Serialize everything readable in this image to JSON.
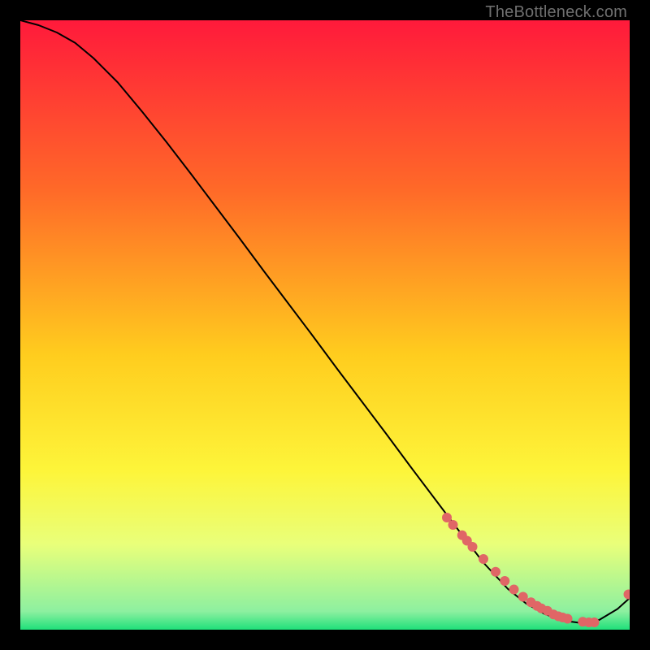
{
  "watermark": "TheBottleneck.com",
  "colors": {
    "background": "#000000",
    "gradient_top": "#ff1a3b",
    "gradient_mid1": "#ff6a28",
    "gradient_mid2": "#ffcd1e",
    "gradient_mid3": "#fdf53a",
    "gradient_bottom_top": "#e9ff7a",
    "gradient_green": "#1fe07a",
    "curve": "#000000",
    "marker": "#e06666"
  },
  "chart_data": {
    "type": "line",
    "title": "",
    "xlabel": "",
    "ylabel": "",
    "xlim": [
      0,
      100
    ],
    "ylim": [
      0,
      100
    ],
    "series": [
      {
        "name": "curve",
        "x": [
          0,
          3,
          6,
          9,
          12,
          16,
          20,
          24,
          28,
          32,
          36,
          40,
          44,
          48,
          52,
          56,
          60,
          64,
          68,
          72,
          76,
          80,
          83,
          86,
          89,
          92,
          95,
          98,
          100
        ],
        "y": [
          100,
          99.2,
          98.0,
          96.3,
          93.8,
          89.8,
          85.0,
          80.0,
          74.8,
          69.5,
          64.2,
          58.8,
          53.5,
          48.2,
          42.8,
          37.5,
          32.2,
          26.8,
          21.5,
          16.2,
          11.0,
          6.7,
          4.3,
          2.6,
          1.5,
          1.1,
          1.6,
          3.4,
          5.2
        ]
      },
      {
        "name": "markers",
        "x": [
          70.0,
          71.0,
          72.5,
          73.3,
          74.2,
          76.0,
          78.0,
          79.5,
          81.0,
          82.5,
          83.8,
          84.8,
          85.5,
          86.5,
          87.5,
          88.3,
          89.0,
          89.8,
          92.3,
          93.3,
          94.2,
          99.8
        ],
        "y": [
          18.4,
          17.2,
          15.5,
          14.6,
          13.6,
          11.6,
          9.5,
          8.0,
          6.6,
          5.4,
          4.5,
          3.9,
          3.5,
          3.1,
          2.5,
          2.2,
          2.0,
          1.8,
          1.3,
          1.2,
          1.2,
          5.8
        ]
      }
    ]
  }
}
